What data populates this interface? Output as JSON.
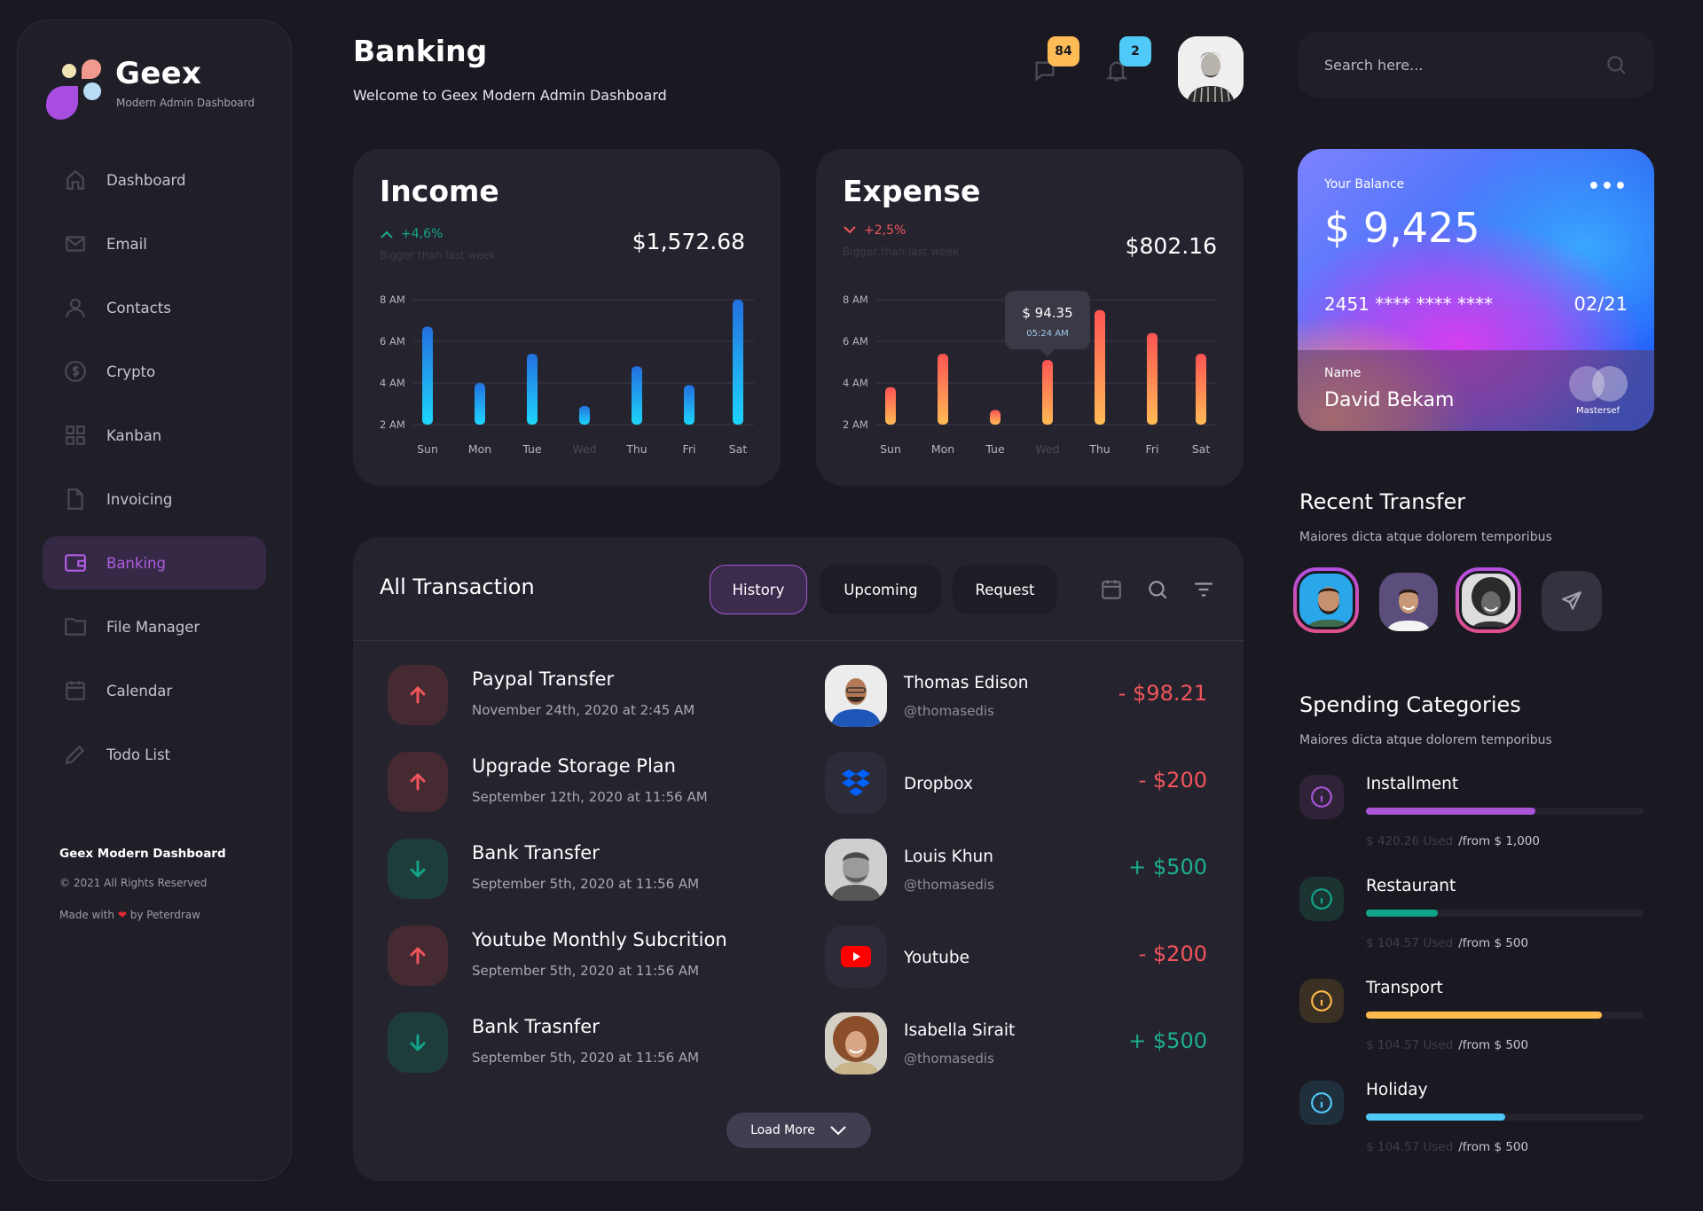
{
  "brand": {
    "name": "Geex",
    "tagline": "Modern Admin Dashboard"
  },
  "sidebar": {
    "items": [
      {
        "label": "Dashboard",
        "icon": "home-icon"
      },
      {
        "label": "Email",
        "icon": "mail-icon"
      },
      {
        "label": "Contacts",
        "icon": "user-icon"
      },
      {
        "label": "Crypto",
        "icon": "dollar-circle-icon"
      },
      {
        "label": "Kanban",
        "icon": "grid-icon"
      },
      {
        "label": "Invoicing",
        "icon": "file-icon"
      },
      {
        "label": "Banking",
        "icon": "wallet-icon",
        "active": true
      },
      {
        "label": "File Manager",
        "icon": "folder-icon"
      },
      {
        "label": "Calendar",
        "icon": "calendar-icon"
      },
      {
        "label": "Todo List",
        "icon": "pencil-icon"
      }
    ],
    "footer": {
      "title": "Geex Modern Dashboard",
      "copyright": "© 2021 All Rights Reserved",
      "made_prefix": "Made with",
      "made_suffix": "by Peterdraw"
    }
  },
  "header": {
    "title": "Banking",
    "subtitle": "Welcome to Geex Modern Admin Dashboard",
    "messages_count": "84",
    "notifications_count": "2",
    "search_placeholder": "Search here..."
  },
  "income": {
    "title": "Income",
    "trend": "+4,6%",
    "trend_direction": "up",
    "trend_note": "Bigger than last week",
    "amount": "$1,572.68"
  },
  "expense": {
    "title": "Expense",
    "trend": "+2,5%",
    "trend_direction": "down",
    "trend_note": "Bigger than last week",
    "amount": "$802.16",
    "tooltip": {
      "value": "$ 94.35",
      "time": "05:24 AM",
      "category": "Wed"
    }
  },
  "chart_data": [
    {
      "type": "bar",
      "title": "Income",
      "categories": [
        "Sun",
        "Mon",
        "Tue",
        "Wed",
        "Thu",
        "Fri",
        "Sat"
      ],
      "values": [
        6.7,
        4.0,
        5.4,
        2.9,
        4.8,
        3.9,
        8.0
      ],
      "yticks": [
        "2 AM",
        "4 AM",
        "6 AM",
        "8 AM"
      ],
      "ylim": [
        2,
        8
      ],
      "grid": true,
      "colors": [
        "#1ed5fb",
        "#2370e0"
      ],
      "muted_category": "Wed"
    },
    {
      "type": "bar",
      "title": "Expense",
      "categories": [
        "Sun",
        "Mon",
        "Tue",
        "Wed",
        "Thu",
        "Fri",
        "Sat"
      ],
      "values": [
        3.8,
        5.4,
        2.7,
        5.1,
        7.5,
        6.4,
        5.4
      ],
      "yticks": [
        "2 AM",
        "4 AM",
        "6 AM",
        "8 AM"
      ],
      "ylim": [
        2,
        8
      ],
      "grid": true,
      "colors": [
        "#ffbb55",
        "#ff5453"
      ],
      "muted_category": "Wed"
    }
  ],
  "card": {
    "balance_label": "Your Balance",
    "balance": "$ 9,425",
    "number": "2451 **** **** ****",
    "expiry": "02/21",
    "name_label": "Name",
    "name": "David Bekam",
    "network": "Mastersef"
  },
  "transactions": {
    "title": "All Transaction",
    "tabs": [
      {
        "label": "History",
        "active": true
      },
      {
        "label": "Upcoming"
      },
      {
        "label": "Request"
      }
    ],
    "rows": [
      {
        "title": "Paypal Transfer",
        "date": "November 24th, 2020 at 2:45 AM",
        "direction": "out",
        "party": "Thomas Edison",
        "handle": "@thomasedis",
        "avatar": "avatar-thomas",
        "amount": "- $98.21",
        "type": "neg"
      },
      {
        "title": "Upgrade Storage Plan",
        "date": "September 12th, 2020 at 11:56 AM",
        "direction": "out",
        "party": "Dropbox",
        "handle": "",
        "avatar": "dropbox-logo",
        "amount": "- $200",
        "type": "neg"
      },
      {
        "title": "Bank Transfer",
        "date": "September 5th, 2020 at 11:56 AM",
        "direction": "in",
        "party": "Louis Khun",
        "handle": "@thomasedis",
        "avatar": "avatar-louis",
        "amount": "+ $500",
        "type": "pos"
      },
      {
        "title": "Youtube Monthly Subcrition",
        "date": "September 5th, 2020 at 11:56 AM",
        "direction": "out",
        "party": "Youtube",
        "handle": "",
        "avatar": "youtube-logo",
        "amount": "- $200",
        "type": "neg"
      },
      {
        "title": "Bank Trasnfer",
        "date": "September 5th, 2020 at 11:56 AM",
        "direction": "in",
        "party": "Isabella Sirait",
        "handle": "@thomasedis",
        "avatar": "avatar-isabella",
        "amount": "+ $500",
        "type": "pos"
      }
    ],
    "load_more": "Load More"
  },
  "recent_transfer": {
    "title": "Recent Transfer",
    "subtitle": "Maiores dicta atque dolorem temporibus"
  },
  "spending": {
    "title": "Spending Categories",
    "subtitle": "Maiores dicta atque dolorem temporibus",
    "items": [
      {
        "name": "Installment",
        "used": "$ 420.26 Used",
        "from": "/from $ 1,000",
        "progress": 0.61,
        "color": "#a855d8",
        "bg": "#2f2338"
      },
      {
        "name": "Restaurant",
        "used": "$ 104.57 Used",
        "from": "/from $ 500",
        "progress": 0.26,
        "color": "#12a48a",
        "bg": "#1b3331"
      },
      {
        "name": "Transport",
        "used": "$ 104.57 Used",
        "from": "/from $ 500",
        "progress": 0.85,
        "color": "#ffb94d",
        "bg": "#3a3024"
      },
      {
        "name": "Holiday",
        "used": "$ 104.57 Used",
        "from": "/from $ 500",
        "progress": 0.5,
        "color": "#4fc9f8",
        "bg": "#1f303c"
      }
    ]
  }
}
